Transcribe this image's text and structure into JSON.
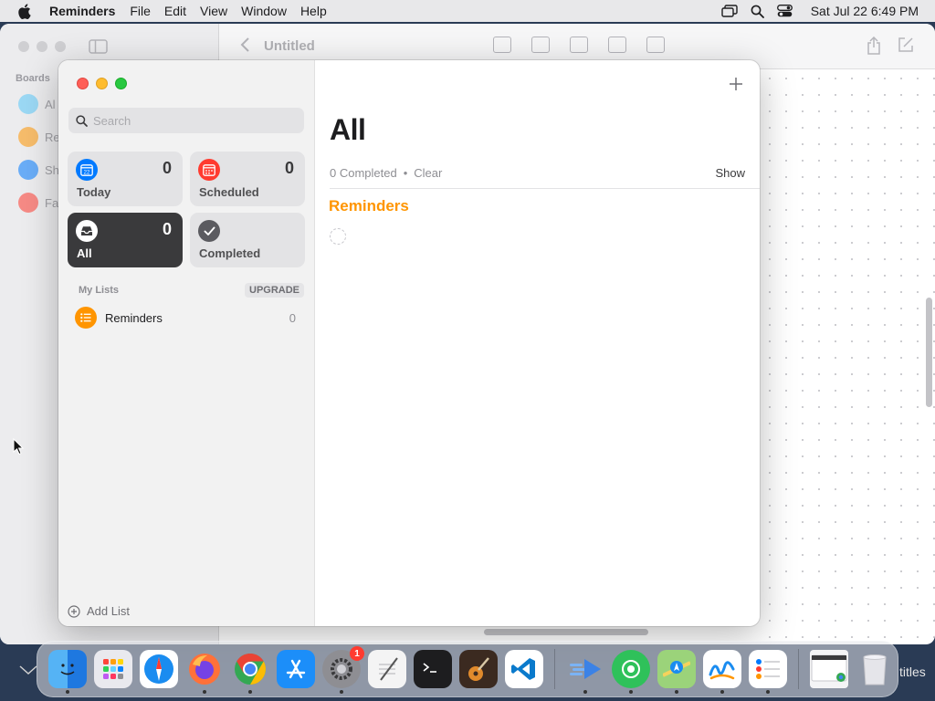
{
  "menubar": {
    "app_name": "Reminders",
    "items": [
      "File",
      "Edit",
      "View",
      "Window",
      "Help"
    ],
    "clock": "Sat Jul 22  6:49 PM"
  },
  "background_window": {
    "title": "Untitled",
    "boards_label": "Boards",
    "items": [
      "Al",
      "Re",
      "Sh",
      "Fa"
    ]
  },
  "reminders": {
    "search_placeholder": "Search",
    "tiles": {
      "today": {
        "label": "Today",
        "count": "0",
        "date": "22"
      },
      "scheduled": {
        "label": "Scheduled",
        "count": "0"
      },
      "all": {
        "label": "All",
        "count": "0"
      },
      "completed": {
        "label": "Completed"
      }
    },
    "my_lists_label": "My Lists",
    "upgrade_label": "UPGRADE",
    "lists": [
      {
        "name": "Reminders",
        "count": "0"
      }
    ],
    "add_list_label": "Add List",
    "main": {
      "title": "All",
      "completed_text": "0 Completed",
      "clear_label": "Clear",
      "show_label": "Show",
      "section_title": "Reminders"
    }
  },
  "dock": {
    "settings_badge": "1",
    "titles_fragment": "titles"
  },
  "colors": {
    "accent_orange": "#ff9500",
    "today_blue": "#007aff",
    "scheduled_red": "#ff3b30",
    "all_dark": "#3a3a3c",
    "completed_gray": "#5b5b60"
  }
}
